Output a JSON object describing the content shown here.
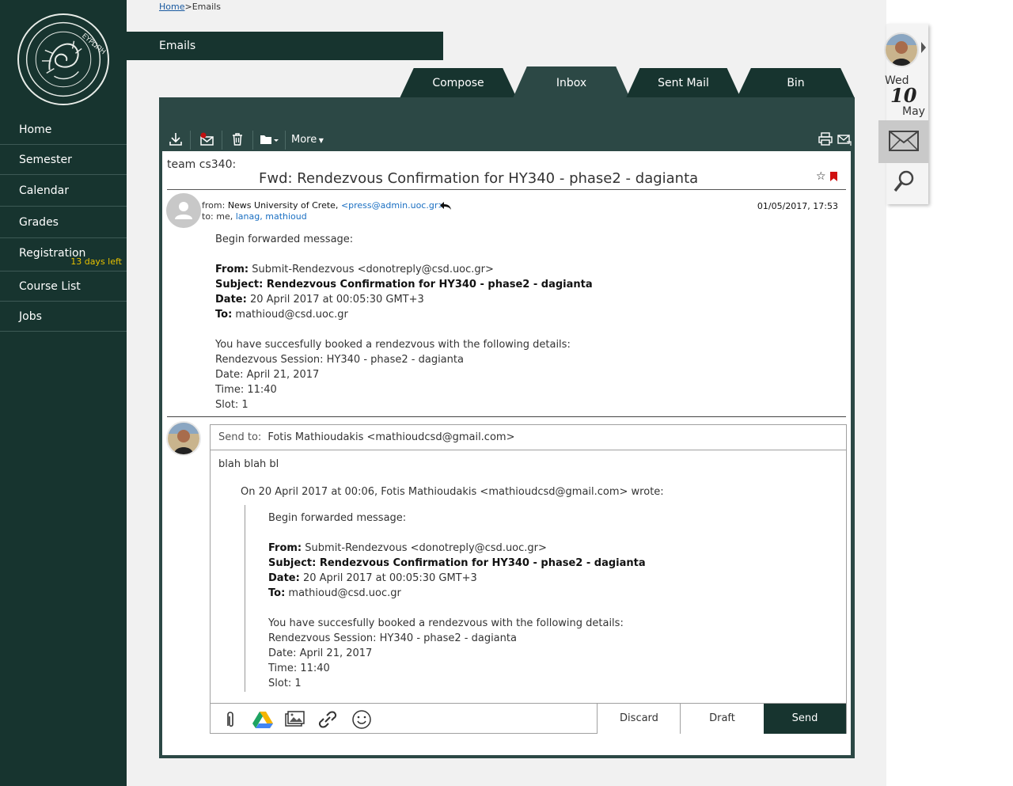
{
  "breadcrumb": {
    "home": "Home",
    "sep": ">",
    "current": "Emails"
  },
  "page_title": "Emails",
  "sidebar": {
    "items": [
      {
        "label": "Home"
      },
      {
        "label": "Semester"
      },
      {
        "label": "Calendar"
      },
      {
        "label": "Grades"
      },
      {
        "label": "Registration",
        "badge": "13 days left"
      },
      {
        "label": "Course List"
      },
      {
        "label": "Jobs"
      }
    ]
  },
  "tabs": [
    {
      "label": "Compose"
    },
    {
      "label": "Inbox",
      "active": true
    },
    {
      "label": "Sent Mail"
    },
    {
      "label": "Bin"
    }
  ],
  "toolbar": {
    "more_label": "More"
  },
  "message": {
    "team": "team cs340:",
    "subject": "Fwd: Rendezvous Confirmation for HY340 - phase2 - dagianta",
    "from_prefix": "from:",
    "from_name": "News University of Crete,",
    "from_email": "<press@admin.uoc.gr>",
    "to_prefix": "to: me,",
    "to_recipients": [
      "lanag,",
      "mathioud"
    ],
    "date": "01/05/2017, 17:53",
    "body": {
      "intro": "Begin forwarded message:",
      "from_label": "From:",
      "from_value": "Submit-Rendezvous <donotreply@csd.uoc.gr>",
      "subject_line": "Subject: Rendezvous Confirmation for HY340 - phase2 - dagianta",
      "date_label": "Date:",
      "date_value": "20 April 2017 at 00:05:30 GMT+3",
      "to_label": "To:",
      "to_value": "mathioud@csd.uoc.gr",
      "line1": "You have succesfully booked a rendezvous with the following details:",
      "line2": "Rendezvous Session: HY340 - phase2 - dagianta",
      "line3": "Date: April 21, 2017",
      "line4": "Time: 11:40",
      "line5": "Slot: 1"
    }
  },
  "reply": {
    "send_to_label": "Send to:",
    "send_to_value": "Fotis Mathioudakis <mathioudcsd@gmail.com>",
    "body": "blah blah bl",
    "quote_header": "On 20 April 2017 at 00:06, Fotis Mathioudakis <mathioudcsd@gmail.com> wrote:",
    "discard_label": "Discard",
    "draft_label": "Draft",
    "send_label": "Send"
  },
  "calendar_widget": {
    "weekday": "Wed",
    "day": "10",
    "month": "May"
  }
}
